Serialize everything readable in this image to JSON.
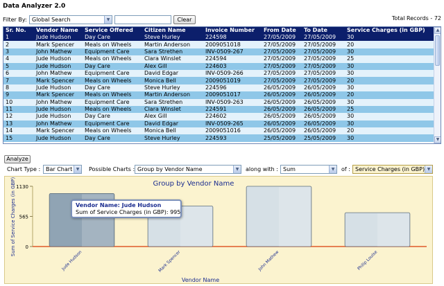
{
  "app": {
    "title": "Data Analyzer 2.0"
  },
  "filter": {
    "label": "Filter By:",
    "selected": "Global Search",
    "search_value": "",
    "clear_label": "Clear",
    "total_records": "Total Records - 72"
  },
  "grid": {
    "columns": [
      "Sr. No.",
      "Vendor Name",
      "Service Offered",
      "Citizen Name",
      "Invoice Number",
      "From Date",
      "To Date",
      "Service Charges (in GBP)"
    ],
    "rows": [
      [
        "1",
        "Jude Hudson",
        "Day Care",
        "Steve Hurley",
        "224598",
        "27/05/2009",
        "27/05/2009",
        "30"
      ],
      [
        "2",
        "Mark Spencer",
        "Meals on Wheels",
        "Martin Anderson",
        "2009051018",
        "27/05/2009",
        "27/05/2009",
        "20"
      ],
      [
        "3",
        "John Mathew",
        "Equipment Care",
        "Sara Strethen",
        "INV-0509-267",
        "27/05/2009",
        "27/05/2009",
        "30"
      ],
      [
        "4",
        "Jude Hudson",
        "Meals on Wheels",
        "Clara Winslet",
        "224594",
        "27/05/2009",
        "27/05/2009",
        "25"
      ],
      [
        "5",
        "Jude Hudson",
        "Day Care",
        "Alex Gill",
        "224603",
        "27/05/2009",
        "27/05/2009",
        "30"
      ],
      [
        "6",
        "John Mathew",
        "Equipment Care",
        "David Edgar",
        "INV-0509-266",
        "27/05/2009",
        "27/05/2009",
        "30"
      ],
      [
        "7",
        "Mark Spencer",
        "Meals on Wheels",
        "Monica Bell",
        "2009051019",
        "27/05/2009",
        "27/05/2009",
        "20"
      ],
      [
        "8",
        "Jude Hudson",
        "Day Care",
        "Steve Hurley",
        "224596",
        "26/05/2009",
        "26/05/2009",
        "30"
      ],
      [
        "9",
        "Mark Spencer",
        "Meals on Wheels",
        "Martin Anderson",
        "2009051017",
        "26/05/2009",
        "26/05/2009",
        "20"
      ],
      [
        "10",
        "John Mathew",
        "Equipment Care",
        "Sara Strethen",
        "INV-0509-263",
        "26/05/2009",
        "26/05/2009",
        "30"
      ],
      [
        "11",
        "Jude Hudson",
        "Meals on Wheels",
        "Clara Winslet",
        "224591",
        "26/05/2009",
        "26/05/2009",
        "25"
      ],
      [
        "12",
        "Jude Hudson",
        "Day Care",
        "Alex Gill",
        "224602",
        "26/05/2009",
        "26/05/2009",
        "30"
      ],
      [
        "13",
        "John Mathew",
        "Equipment Care",
        "David Edgar",
        "INV-0509-265",
        "26/05/2009",
        "26/05/2009",
        "30"
      ],
      [
        "14",
        "Mark Spencer",
        "Meals on Wheels",
        "Monica Bell",
        "2009051016",
        "26/05/2009",
        "26/05/2009",
        "20"
      ],
      [
        "15",
        "Jude Hudson",
        "Day Care",
        "Steve Hurley",
        "224593",
        "25/05/2009",
        "25/05/2009",
        "30"
      ]
    ],
    "selected_row": 0
  },
  "analyze": {
    "label": "Analyze"
  },
  "options": {
    "chart_type_label": "Chart Type :",
    "chart_type_value": "Bar Chart",
    "possible_charts_label": "Possible Charts :",
    "possible_charts_value": "Group by Vendor Name",
    "along_with_label": "along with :",
    "along_with_value": "Sum",
    "of_label": "of :",
    "of_value": "Service Charges (in GBP)"
  },
  "tooltip": {
    "title": "Vendor Name: Jude Hudson",
    "value": "Sum of Service Charges (in GBP): 995"
  },
  "chart_data": {
    "type": "bar",
    "title": "Group by Vendor Name",
    "xlabel": "Vendor Name",
    "ylabel": "Sum of Service Charges (in GBP)",
    "categories": [
      "Jude Hudson",
      "Mark Spencer",
      "John Mathew",
      "Philip Louise"
    ],
    "values": [
      995,
      760,
      1130,
      635
    ],
    "yticks": [
      0,
      565,
      1130
    ],
    "ylim": [
      0,
      1130
    ],
    "highlighted": 0,
    "colors": {
      "bar": "#d6e0e6",
      "bar_highlight": "#90a4b4",
      "panel": "#fbf3cf",
      "title": "#1a2c8f"
    }
  }
}
